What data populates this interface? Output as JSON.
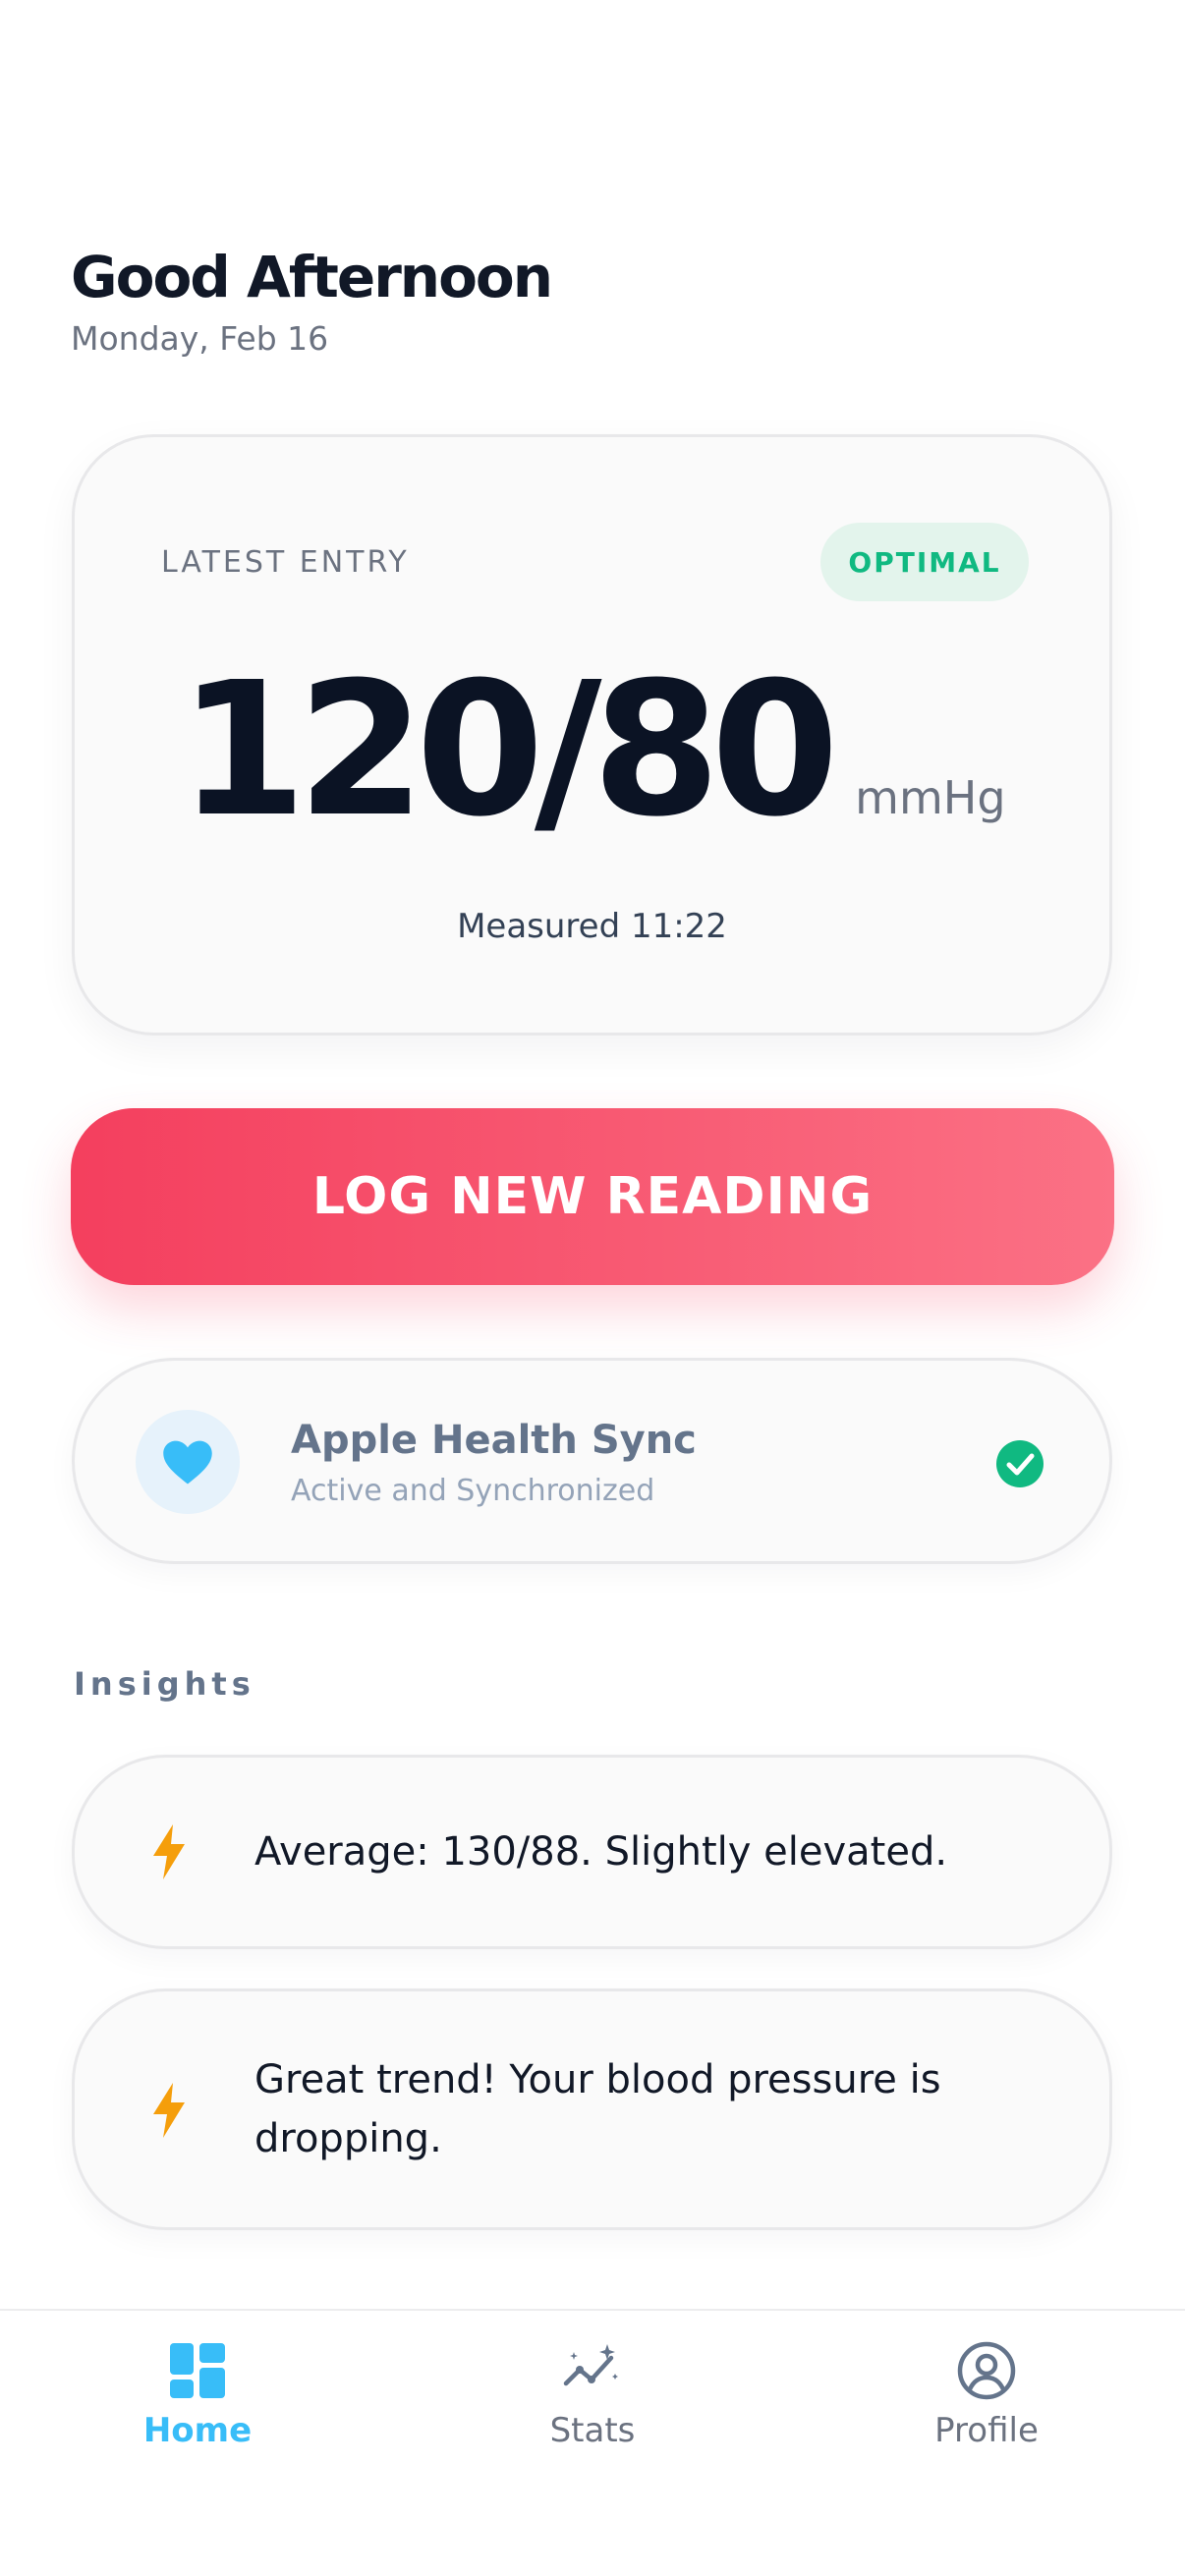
{
  "header": {
    "greeting": "Good Afternoon",
    "date": "Monday, Feb 16"
  },
  "latest_entry": {
    "label": "LATEST ENTRY",
    "status": "OPTIMAL",
    "reading": "120/80",
    "unit": "mmHg",
    "measured": "Measured 11:22",
    "colors": {
      "status_text": "#10b981",
      "status_bg": "#e3f4ec"
    }
  },
  "cta": {
    "label": "LOG NEW READING",
    "colors": {
      "start": "#f43f5e",
      "end": "#fb7185"
    }
  },
  "sync": {
    "icon": "heart-icon",
    "title": "Apple Health Sync",
    "subtitle": "Active and Synchronized",
    "status_icon": "check-circle-icon",
    "colors": {
      "heart": "#38bdf8",
      "check": "#10b981"
    }
  },
  "insights": {
    "title": "Insights",
    "items": [
      {
        "icon": "bolt-icon",
        "text": "Average: 130/88. Slightly elevated."
      },
      {
        "icon": "bolt-icon",
        "text": "Great trend! Your blood pressure is dropping."
      }
    ],
    "colors": {
      "bolt": "#f59e0b"
    }
  },
  "nav": {
    "items": [
      {
        "icon": "dashboard-icon",
        "label": "Home",
        "active": true
      },
      {
        "icon": "chart-sparkle-icon",
        "label": "Stats",
        "active": false
      },
      {
        "icon": "user-circle-icon",
        "label": "Profile",
        "active": false
      }
    ],
    "colors": {
      "active": "#38bdf8",
      "inactive": "#6b7280"
    }
  }
}
